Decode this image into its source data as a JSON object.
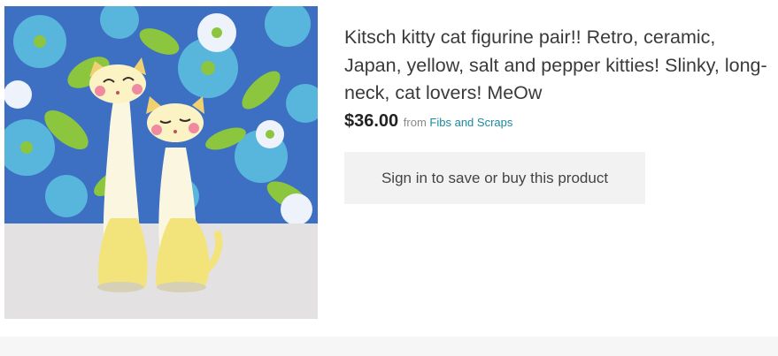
{
  "product": {
    "title": "Kitsch kitty cat figurine pair!! Retro, ceramic, Japan, yellow, salt and pepper kitties! Slinky, long-neck, cat lovers! MeOw",
    "price": "$36.00",
    "from_label": "from",
    "shop_name": "Fibs and Scraps",
    "image_alt": "Two yellow ceramic cat figurines in front of floral fabric"
  },
  "action": {
    "signin_label": "Sign in to save or buy this product"
  },
  "colors": {
    "price": "#222222",
    "shop_link": "#1a8a9e",
    "button_bg": "#f2f2f2"
  }
}
